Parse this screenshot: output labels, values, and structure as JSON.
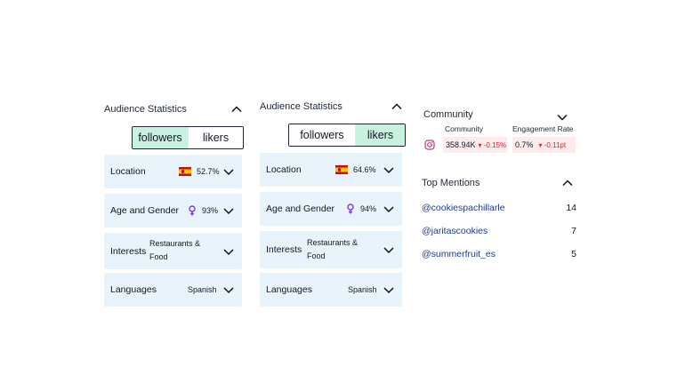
{
  "left_panel": {
    "title": "Audience Statistics",
    "segments": {
      "followers": "followers",
      "likers": "likers",
      "active": "followers"
    },
    "location": {
      "label": "Location",
      "value": "52.7%"
    },
    "age_gender": {
      "label": "Age and Gender",
      "value": "93%"
    },
    "interests": {
      "label": "Interests",
      "value_line1": "Restaurants &",
      "value_line2": "Food"
    },
    "languages": {
      "label": "Languages",
      "value": "Spanish"
    }
  },
  "mid_panel": {
    "title": "Audience Statistics",
    "segments": {
      "followers": "followers",
      "likers": "likers",
      "active": "likers"
    },
    "location": {
      "label": "Location",
      "value": "64.6%"
    },
    "age_gender": {
      "label": "Age and Gender",
      "value": "94%"
    },
    "interests": {
      "label": "Interests",
      "value_line1": "Restaurants &",
      "value_line2": "Food"
    },
    "languages": {
      "label": "Languages",
      "value": "Spanish"
    }
  },
  "community": {
    "title": "Community",
    "col_community": "Community",
    "col_engagement": "Engagement Rate",
    "network_icon": "instagram-icon",
    "community_value": "358.94K",
    "community_delta": "▾ -0.15%",
    "engagement_value": "0.7%",
    "engagement_delta": "▾ -0.11pt"
  },
  "top_mentions": {
    "title": "Top Mentions",
    "items": [
      {
        "handle": "@cookiespachillarle",
        "count": "14"
      },
      {
        "handle": "@jaritascookies",
        "count": "7"
      },
      {
        "handle": "@summerfruit_es",
        "count": "5"
      }
    ]
  },
  "colors": {
    "card_bg": "#e8f3fb",
    "active_segment": "#c9f1df",
    "negative": "#e11d2e",
    "metric_bg": "#fdecec",
    "instagram": "#c13584"
  }
}
